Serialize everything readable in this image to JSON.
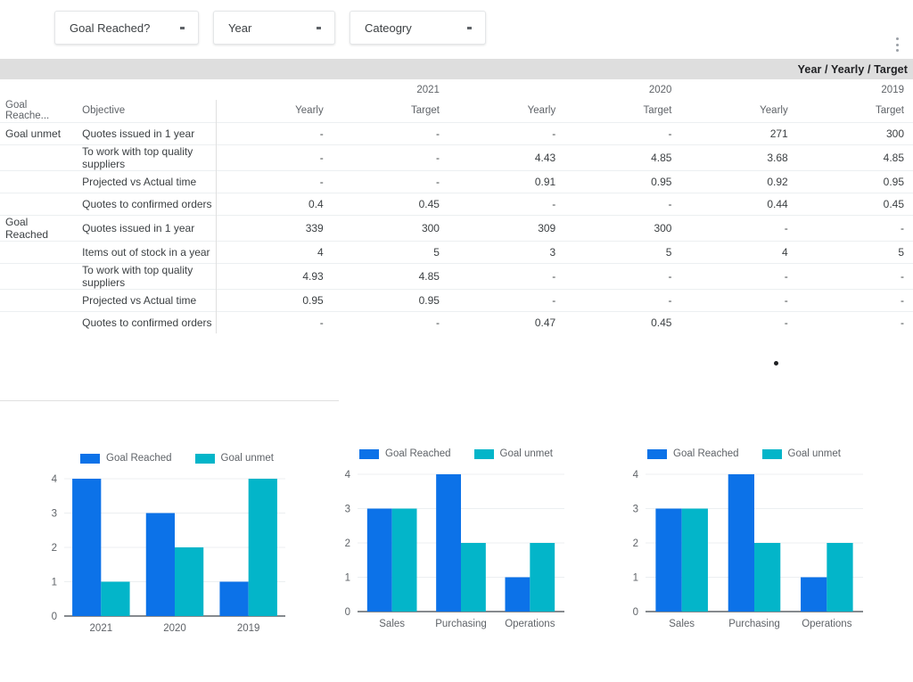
{
  "filters": [
    {
      "label": "Goal Reached?",
      "icon": "chevron-down-icon"
    },
    {
      "label": "Year",
      "icon": "chevron-down-icon"
    },
    {
      "label": "Cateogry",
      "icon": "chevron-down-icon"
    }
  ],
  "overflow_menu": {
    "icon": "kebab-menu-icon"
  },
  "band": {
    "title": "Year / Yearly / Target"
  },
  "table": {
    "dim_headers": [
      "Goal Reache...",
      "Objective"
    ],
    "year_groups": [
      {
        "year": "2021",
        "span": 2
      },
      {
        "year": "2020",
        "span": 2
      },
      {
        "year": "2019",
        "span": 2
      }
    ],
    "measure_headers": [
      "Yearly",
      "Target",
      "Yearly",
      "Target",
      "Yearly",
      "Target"
    ],
    "rows": [
      {
        "dim1": "Goal unmet",
        "dim2": "Quotes issued in 1 year",
        "values": [
          "-",
          "-",
          "-",
          "-",
          "271",
          "300"
        ]
      },
      {
        "dim1": "",
        "dim2": "To work with top quality suppliers",
        "values": [
          "-",
          "-",
          "4.43",
          "4.85",
          "3.68",
          "4.85"
        ]
      },
      {
        "dim1": "",
        "dim2": "Projected vs Actual time",
        "values": [
          "-",
          "-",
          "0.91",
          "0.95",
          "0.92",
          "0.95"
        ]
      },
      {
        "dim1": "",
        "dim2": "Quotes to confirmed orders",
        "values": [
          "0.4",
          "0.45",
          "-",
          "-",
          "0.44",
          "0.45"
        ]
      },
      {
        "dim1": "Goal Reached",
        "dim2": "Quotes issued in 1 year",
        "values": [
          "339",
          "300",
          "309",
          "300",
          "-",
          "-"
        ]
      },
      {
        "dim1": "",
        "dim2": "Items out of stock in a year",
        "values": [
          "4",
          "5",
          "3",
          "5",
          "4",
          "5"
        ]
      },
      {
        "dim1": "",
        "dim2": "To work with top quality suppliers",
        "values": [
          "4.93",
          "4.85",
          "-",
          "-",
          "-",
          "-"
        ]
      },
      {
        "dim1": "",
        "dim2": "Projected vs Actual time",
        "values": [
          "0.95",
          "0.95",
          "-",
          "-",
          "-",
          "-"
        ]
      },
      {
        "dim1": "",
        "dim2": "Quotes to confirmed orders",
        "values": [
          "-",
          "-",
          "0.47",
          "0.45",
          "-",
          "-"
        ]
      }
    ]
  },
  "colors": {
    "series_goal_reached": "#0c72e8",
    "series_goal_unmet": "#03b5c9",
    "band_background": "#dedede",
    "grid": "#eceff1",
    "axis": "#5f6368"
  },
  "chart_data": [
    {
      "type": "bar",
      "title": "",
      "categories": [
        "2021",
        "2020",
        "2019"
      ],
      "series": [
        {
          "name": "Goal Reached",
          "values": [
            4,
            3,
            1
          ],
          "color": "#0c72e8"
        },
        {
          "name": "Goal unmet",
          "values": [
            1,
            2,
            4
          ],
          "color": "#03b5c9"
        }
      ],
      "xlabel": "",
      "ylabel": "",
      "ylim": [
        0,
        4
      ],
      "yticks": [
        0,
        1,
        2,
        3,
        4
      ],
      "grid": true,
      "legend": "top"
    },
    {
      "type": "bar",
      "title": "",
      "categories": [
        "Sales",
        "Purchasing",
        "Operations"
      ],
      "series": [
        {
          "name": "Goal Reached",
          "values": [
            3,
            4,
            1
          ],
          "color": "#0c72e8"
        },
        {
          "name": "Goal unmet",
          "values": [
            3,
            2,
            2
          ],
          "color": "#03b5c9"
        }
      ],
      "xlabel": "",
      "ylabel": "",
      "ylim": [
        0,
        4
      ],
      "yticks": [
        0,
        1,
        2,
        3,
        4
      ],
      "grid": true,
      "legend": "top"
    },
    {
      "type": "bar",
      "title": "",
      "categories": [
        "Sales",
        "Purchasing",
        "Operations"
      ],
      "series": [
        {
          "name": "Goal Reached",
          "values": [
            3,
            4,
            1
          ],
          "color": "#0c72e8"
        },
        {
          "name": "Goal unmet",
          "values": [
            3,
            2,
            2
          ],
          "color": "#03b5c9"
        }
      ],
      "xlabel": "",
      "ylabel": "",
      "ylim": [
        0,
        4
      ],
      "yticks": [
        0,
        1,
        2,
        3,
        4
      ],
      "grid": true,
      "legend": "top"
    }
  ]
}
